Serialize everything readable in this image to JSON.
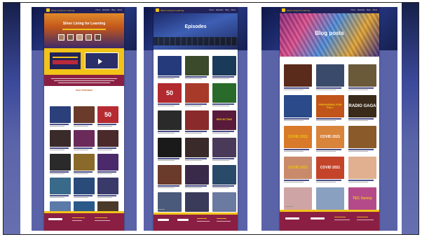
{
  "screenshot": {
    "left_page": {
      "site_name": "Silver Lining for Learning",
      "nav": [
        "Home",
        "Episodes",
        "Blog",
        "About"
      ],
      "hero_title": "Silver Lining for Learning",
      "section_title": "PAST EPISODES",
      "thumbnail_texts": [
        "50"
      ]
    },
    "middle_page": {
      "site_name": "Silver Lining for Learning",
      "nav": [
        "Home",
        "Episodes",
        "Blog",
        "About"
      ],
      "hero_title": "Episodes",
      "thumbnail_texts": [
        "50",
        "REFLECTING"
      ]
    },
    "right_page": {
      "site_name": "Silver Lining for Learning",
      "nav": [
        "Home",
        "Episodes",
        "Blog",
        "About"
      ],
      "hero_title": "Blog posts",
      "thumbnail_texts": [
        "PREPARING FOR FALL",
        "RADIO GAGA",
        "COVID 2021",
        "COVID 2021",
        "COVID 2021",
        "COVID 2021",
        "TEC Variety"
      ]
    }
  },
  "colors": {
    "navy": "#22235a",
    "gold": "#f2c318",
    "maroon": "#8b1f43",
    "periwinkle": "#5a63a8"
  }
}
